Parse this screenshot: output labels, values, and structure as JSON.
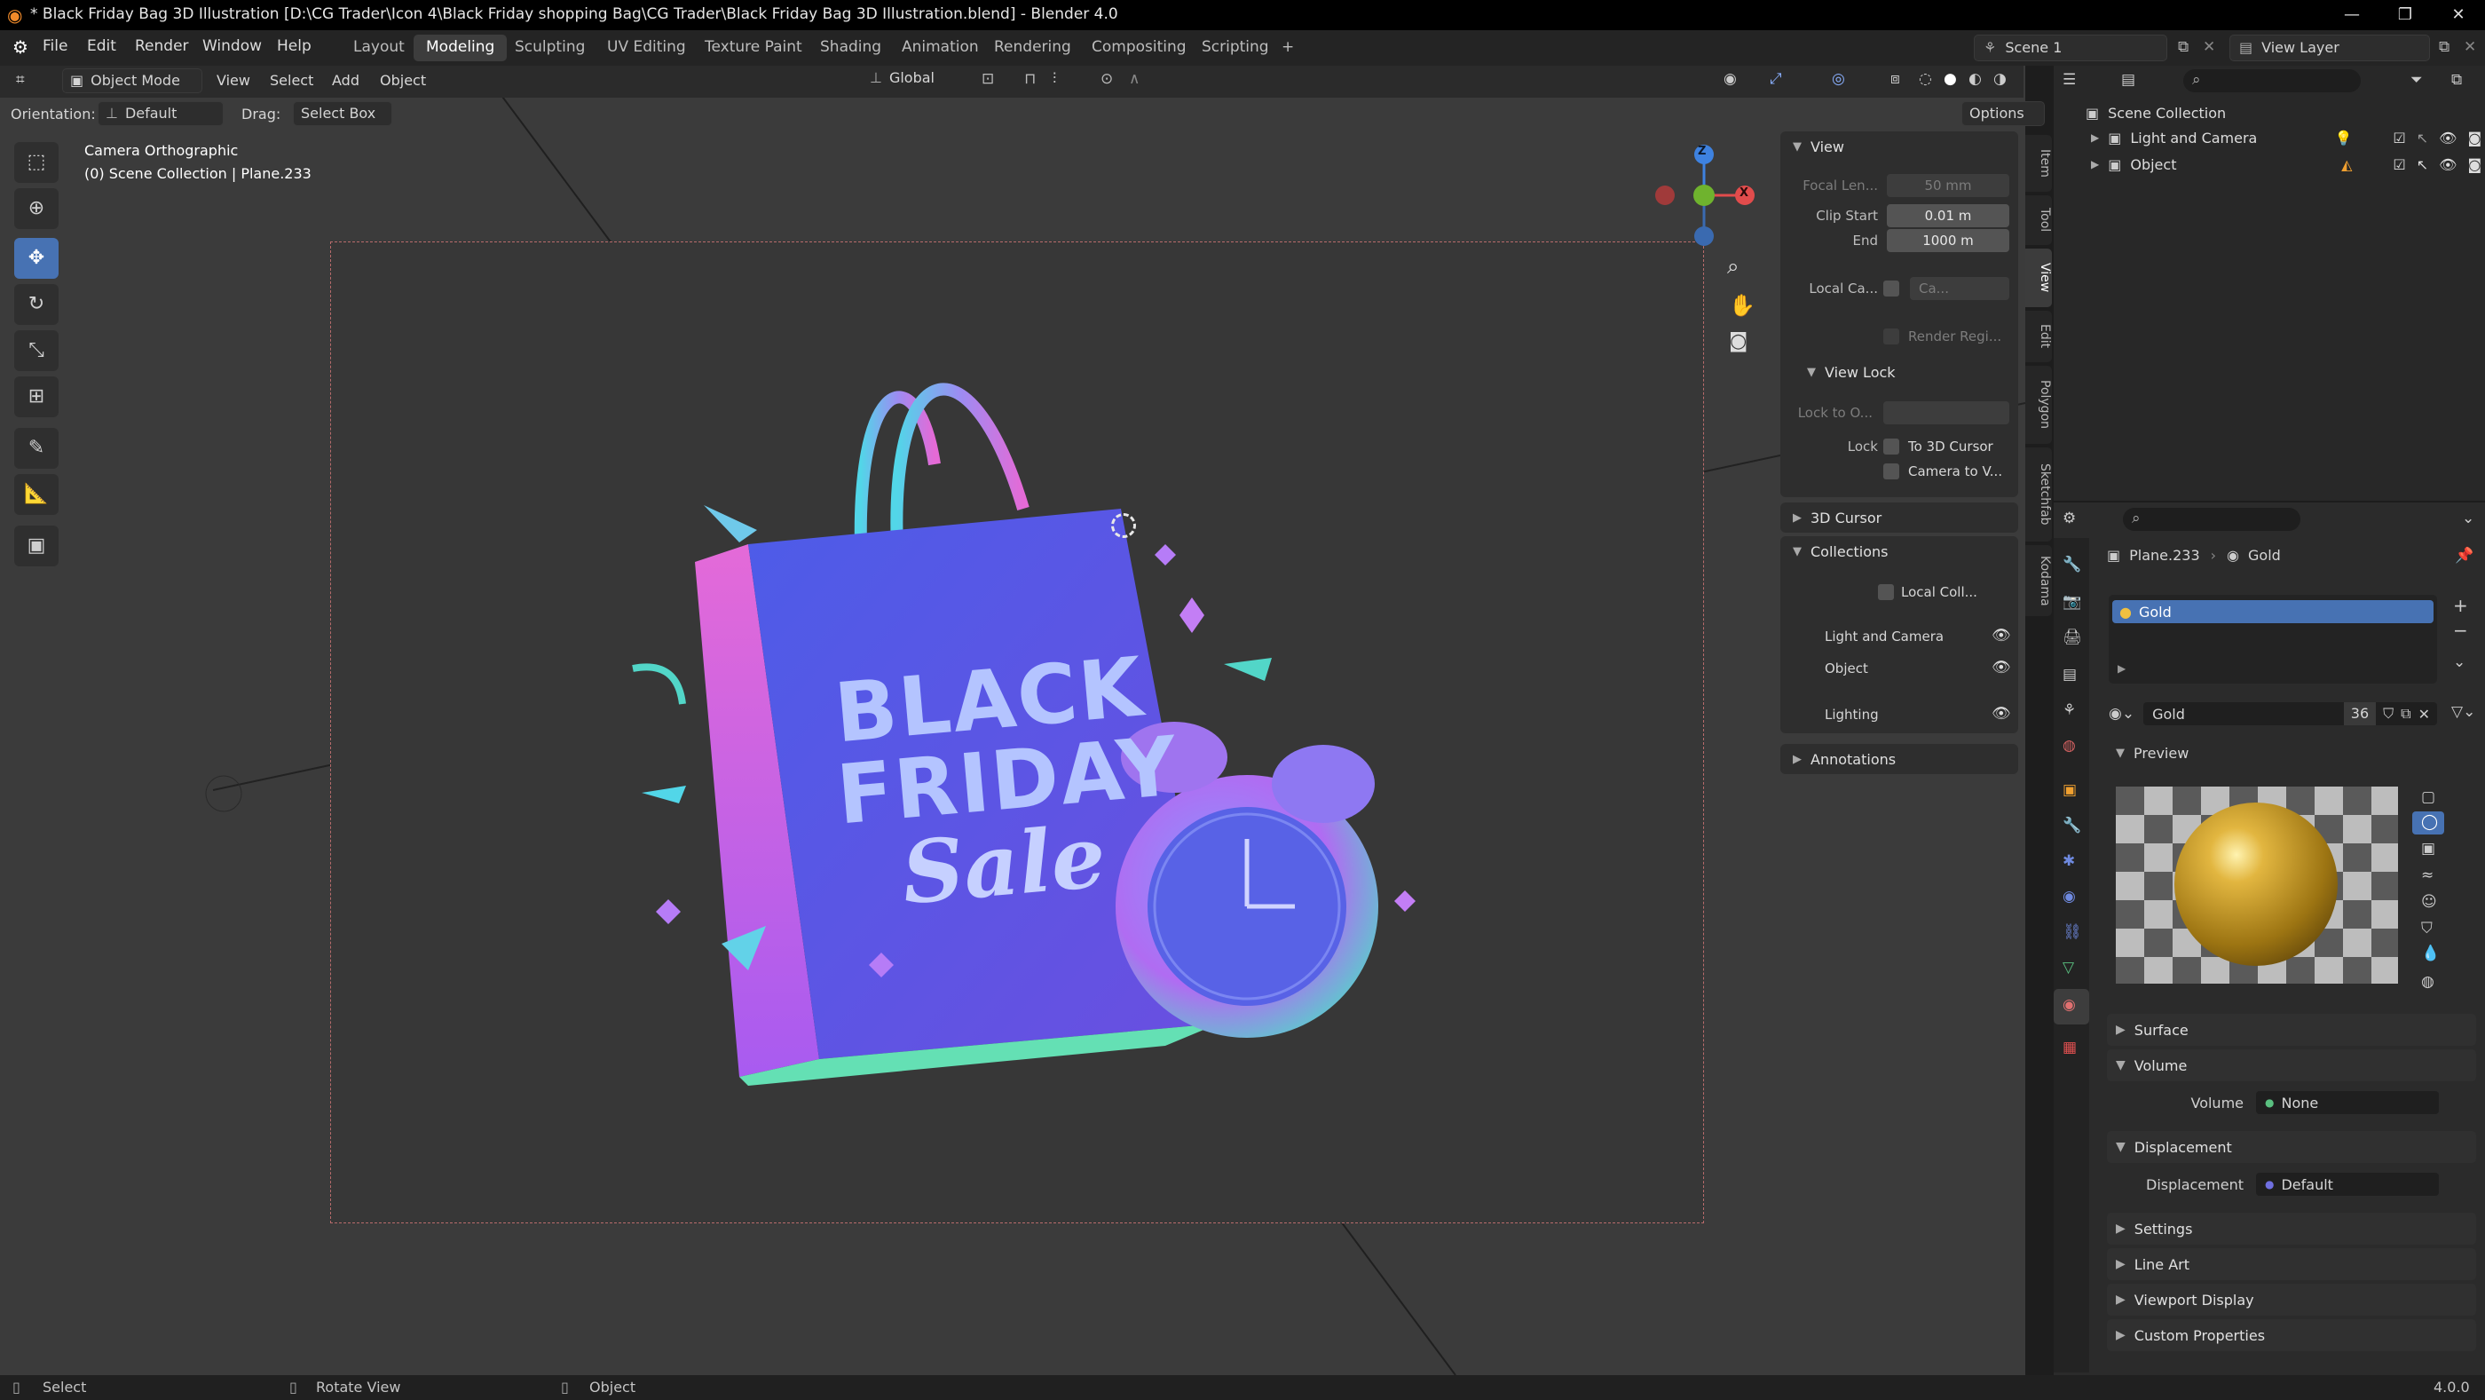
{
  "titlebar": {
    "title": "* Black Friday Bag 3D Illustration [D:\\CG Trader\\Icon 4\\Black Friday shopping Bag\\CG Trader\\Black Friday Bag 3D Illustration.blend] - Blender 4.0",
    "min": "—",
    "max": "❐",
    "close": "✕"
  },
  "menubar": {
    "menus": [
      "File",
      "Edit",
      "Render",
      "Window",
      "Help"
    ],
    "workspaces": [
      "Layout",
      "Modeling",
      "Sculpting",
      "UV Editing",
      "Texture Paint",
      "Shading",
      "Animation",
      "Rendering",
      "Compositing",
      "Scripting"
    ],
    "add_ws": "+",
    "scene": "Scene 1",
    "view_layer": "View Layer"
  },
  "header": {
    "mode": "Object Mode",
    "menus": [
      "View",
      "Select",
      "Add",
      "Object"
    ],
    "orientation_global": "Global",
    "orientation_label": "Orientation:",
    "orientation_value": "Default",
    "drag_label": "Drag:",
    "drag_value": "Select Box",
    "options": "Options"
  },
  "viewport": {
    "camera": "Camera Orthographic",
    "collection": "(0) Scene Collection | Plane.233",
    "axis_z": "Z",
    "axis_x": "X",
    "art_line1": "BLACK",
    "art_line2": "FRIDAY",
    "art_line3": "Sale"
  },
  "npanel": {
    "tabs": [
      "Item",
      "Tool",
      "View",
      "Edit",
      "Polygon",
      "Sketchfab",
      "Kodama"
    ],
    "view_header": "View",
    "focal_label": "Focal Len...",
    "focal_value": "50 mm",
    "clip_start_label": "Clip Start",
    "clip_start_value": "0.01 m",
    "end_label": "End",
    "end_value": "1000 m",
    "local_cam_label": "Local Ca...",
    "local_cam_value": "Ca...",
    "render_region": "Render Regi...",
    "view_lock": "View Lock",
    "lock_to_label": "Lock to O...",
    "lock_label": "Lock",
    "to_cursor": "To 3D Cursor",
    "camera_to_view": "Camera to V...",
    "cursor_header": "3D Cursor",
    "collections_header": "Collections",
    "local_coll": "Local Coll...",
    "collections": [
      "Light and Camera",
      "Object",
      "Lighting"
    ],
    "annotations": "Annotations"
  },
  "outliner": {
    "scene_collection": "Scene Collection",
    "items": [
      "Light and Camera",
      "Object"
    ]
  },
  "properties": {
    "breadcrumb_object": "Plane.233",
    "breadcrumb_material": "Gold",
    "slot": "Gold",
    "material_name": "Gold",
    "users": "36",
    "preview": "Preview",
    "surface": "Surface",
    "volume": "Volume",
    "volume_label": "Volume",
    "volume_value": "None",
    "displacement": "Displacement",
    "displacement_label": "Displacement",
    "displacement_value": "Default",
    "settings": "Settings",
    "line_art": "Line Art",
    "viewport_display": "Viewport Display",
    "custom_properties": "Custom Properties"
  },
  "statusbar": {
    "select": "Select",
    "rotate": "Rotate View",
    "object": "Object",
    "version": "4.0.0"
  },
  "colors": {
    "accent": "#4772b3",
    "bag": "#5b63e6",
    "gold": "#c9a227"
  }
}
